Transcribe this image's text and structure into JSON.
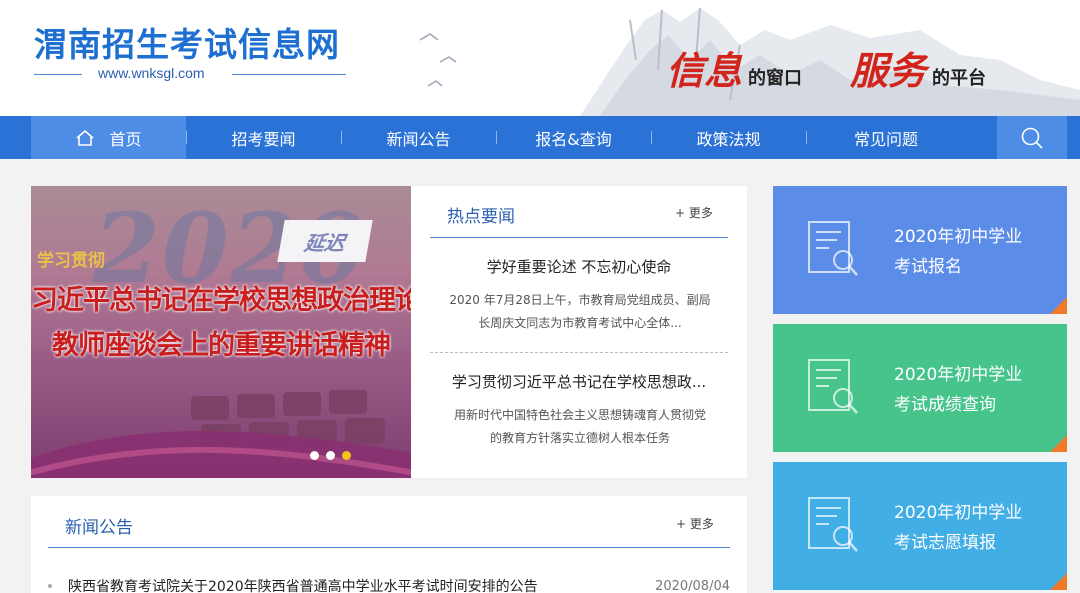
{
  "header": {
    "site_title": "渭南招生考试信息网",
    "site_url": "www.wnksgl.com",
    "slogan": [
      {
        "big": "信息",
        "small": "的窗口"
      },
      {
        "big": "服务",
        "small": "的平台"
      }
    ]
  },
  "nav": {
    "items": [
      {
        "label": "首页",
        "icon": "home-icon",
        "active": true
      },
      {
        "label": "招考要闻"
      },
      {
        "label": "新闻公告"
      },
      {
        "label": "报名&查询"
      },
      {
        "label": "政策法规"
      },
      {
        "label": "常见问题"
      }
    ],
    "search_icon": "search-icon"
  },
  "banner": {
    "year_art": "2020",
    "tag": "延迟",
    "kicker": "学习贯彻",
    "line1": "习近平总书记在学校思想政治理论课",
    "line2": "教师座谈会上的重要讲话精神",
    "slides": 3,
    "active_slide": 3
  },
  "hot_news": {
    "title": "热点要闻",
    "more": "+ 更多",
    "items": [
      {
        "headline": "学好重要论述 不忘初心使命",
        "summary_lines": [
          "2020 年7月28日上午，市教育局党组成员、副局",
          "长周庆文同志为市教育考试中心全体..."
        ]
      },
      {
        "headline": "学习贯彻习近平总书记在学校思想政...",
        "summary_lines": [
          "用新时代中国特色社会主义思想铸魂育人贯彻党",
          "的教育方针落实立德树人根本任务"
        ]
      }
    ]
  },
  "notices": {
    "title": "新闻公告",
    "more": "+ 更多",
    "items": [
      {
        "title": "陕西省教育考试院关于2020年陕西省普通高中学业水平考试时间安排的公告",
        "date": "2020/08/04"
      }
    ]
  },
  "cards": [
    {
      "line1": "2020年初中学业",
      "line2": "考试报名",
      "color": "#5b8de8"
    },
    {
      "line1": "2020年初中学业",
      "line2": "考试成绩查询",
      "color": "#46c48c"
    },
    {
      "line1": "2020年初中学业",
      "line2": "考试志愿填报",
      "color": "#42aee6"
    }
  ],
  "colors": {
    "brand_blue": "#2b72d7",
    "nav_active": "#4d8de6",
    "slogan_red": "#d3241c",
    "accent_orange": "#f07a2a",
    "slide_dot_active": "#f2c318"
  }
}
